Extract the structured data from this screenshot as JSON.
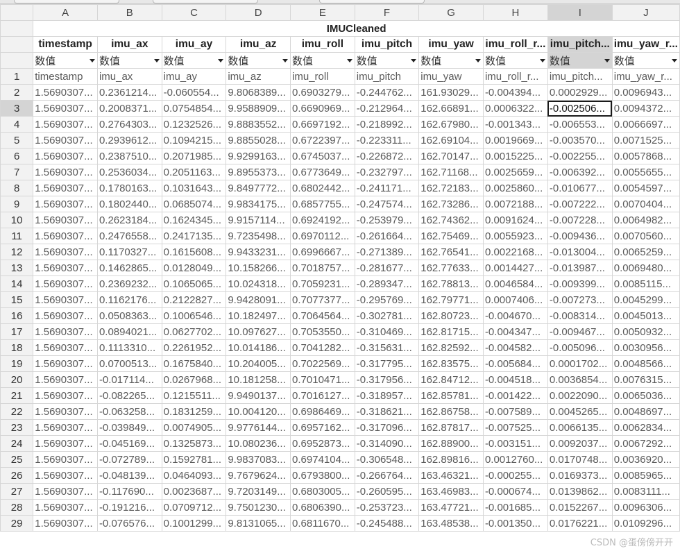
{
  "sheet": {
    "title": "IMUCleaned",
    "column_letters": [
      "A",
      "B",
      "C",
      "D",
      "E",
      "F",
      "G",
      "H",
      "I",
      "J"
    ],
    "selected_column": 8,
    "selected_row": 3,
    "field_names": [
      "timestamp",
      "imu_ax",
      "imu_ay",
      "imu_az",
      "imu_roll",
      "imu_pitch",
      "imu_yaw",
      "imu_roll_r...",
      "imu_pitch...",
      "imu_yaw_r..."
    ],
    "type_labels": [
      "数值",
      "数值",
      "数值",
      "数值",
      "数值",
      "数值",
      "数值",
      "数值",
      "数值",
      "数值"
    ],
    "rows": [
      {
        "n": "1",
        "cells": [
          "timestamp",
          "imu_ax",
          "imu_ay",
          "imu_az",
          "imu_roll",
          "imu_pitch",
          "imu_yaw",
          "imu_roll_r...",
          "imu_pitch...",
          "imu_yaw_r..."
        ]
      },
      {
        "n": "2",
        "cells": [
          "1.5690307...",
          "0.2361214...",
          "-0.060554...",
          "9.8068389...",
          "0.6903279...",
          "-0.244762...",
          "161.93029...",
          "-0.004394...",
          "0.0002929...",
          "0.0096943..."
        ]
      },
      {
        "n": "3",
        "cells": [
          "1.5690307...",
          "0.2008371...",
          "0.0754854...",
          "9.9588909...",
          "0.6690969...",
          "-0.212964...",
          "162.66891...",
          "0.0006322...",
          "-0.002506...",
          "0.0094372..."
        ]
      },
      {
        "n": "4",
        "cells": [
          "1.5690307...",
          "0.2764303...",
          "0.1232526...",
          "9.8883552...",
          "0.6697192...",
          "-0.218992...",
          "162.67980...",
          "-0.001343...",
          "-0.006553...",
          "0.0066697..."
        ]
      },
      {
        "n": "5",
        "cells": [
          "1.5690307...",
          "0.2939612...",
          "0.1094215...",
          "9.8855028...",
          "0.6722397...",
          "-0.223311...",
          "162.69104...",
          "0.0019669...",
          "-0.003570...",
          "0.0071525..."
        ]
      },
      {
        "n": "6",
        "cells": [
          "1.5690307...",
          "0.2387510...",
          "0.2071985...",
          "9.9299163...",
          "0.6745037...",
          "-0.226872...",
          "162.70147...",
          "0.0015225...",
          "-0.002255...",
          "0.0057868..."
        ]
      },
      {
        "n": "7",
        "cells": [
          "1.5690307...",
          "0.2536034...",
          "0.2051163...",
          "9.8955373...",
          "0.6773649...",
          "-0.232797...",
          "162.71168...",
          "0.0025659...",
          "-0.006392...",
          "0.0055655..."
        ]
      },
      {
        "n": "8",
        "cells": [
          "1.5690307...",
          "0.1780163...",
          "0.1031643...",
          "9.8497772...",
          "0.6802442...",
          "-0.241171...",
          "162.72183...",
          "0.0025860...",
          "-0.010677...",
          "0.0054597..."
        ]
      },
      {
        "n": "9",
        "cells": [
          "1.5690307...",
          "0.1802440...",
          "0.0685074...",
          "9.9834175...",
          "0.6857755...",
          "-0.247574...",
          "162.73286...",
          "0.0072188...",
          "-0.007222...",
          "0.0070404..."
        ]
      },
      {
        "n": "10",
        "cells": [
          "1.5690307...",
          "0.2623184...",
          "0.1624345...",
          "9.9157114...",
          "0.6924192...",
          "-0.253979...",
          "162.74362...",
          "0.0091624...",
          "-0.007228...",
          "0.0064982..."
        ]
      },
      {
        "n": "11",
        "cells": [
          "1.5690307...",
          "0.2476558...",
          "0.2417135...",
          "9.7235498...",
          "0.6970112...",
          "-0.261664...",
          "162.75469...",
          "0.0055923...",
          "-0.009436...",
          "0.0070560..."
        ]
      },
      {
        "n": "12",
        "cells": [
          "1.5690307...",
          "0.1170327...",
          "0.1615608...",
          "9.9433231...",
          "0.6996667...",
          "-0.271389...",
          "162.76541...",
          "0.0022168...",
          "-0.013004...",
          "0.0065259..."
        ]
      },
      {
        "n": "13",
        "cells": [
          "1.5690307...",
          "0.1462865...",
          "0.0128049...",
          "10.158266...",
          "0.7018757...",
          "-0.281677...",
          "162.77633...",
          "0.0014427...",
          "-0.013987...",
          "0.0069480..."
        ]
      },
      {
        "n": "14",
        "cells": [
          "1.5690307...",
          "0.2369232...",
          "0.1065065...",
          "10.024318...",
          "0.7059231...",
          "-0.289347...",
          "162.78813...",
          "0.0046584...",
          "-0.009399...",
          "0.0085115..."
        ]
      },
      {
        "n": "15",
        "cells": [
          "1.5690307...",
          "0.1162176...",
          "0.2122827...",
          "9.9428091...",
          "0.7077377...",
          "-0.295769...",
          "162.79771...",
          "0.0007406...",
          "-0.007273...",
          "0.0045299..."
        ]
      },
      {
        "n": "16",
        "cells": [
          "1.5690307...",
          "0.0508363...",
          "0.1006546...",
          "10.182497...",
          "0.7064564...",
          "-0.302781...",
          "162.80723...",
          "-0.004670...",
          "-0.008314...",
          "0.0045013..."
        ]
      },
      {
        "n": "17",
        "cells": [
          "1.5690307...",
          "0.0894021...",
          "0.0627702...",
          "10.097627...",
          "0.7053550...",
          "-0.310469...",
          "162.81715...",
          "-0.004347...",
          "-0.009467...",
          "0.0050932..."
        ]
      },
      {
        "n": "18",
        "cells": [
          "1.5690307...",
          "0.1113310...",
          "0.2261952...",
          "10.014186...",
          "0.7041282...",
          "-0.315631...",
          "162.82592...",
          "-0.004582...",
          "-0.005096...",
          "0.0030956..."
        ]
      },
      {
        "n": "19",
        "cells": [
          "1.5690307...",
          "0.0700513...",
          "0.1675840...",
          "10.204005...",
          "0.7022569...",
          "-0.317795...",
          "162.83575...",
          "-0.005684...",
          "0.0001702...",
          "0.0048566..."
        ]
      },
      {
        "n": "20",
        "cells": [
          "1.5690307...",
          "-0.017114...",
          "0.0267968...",
          "10.181258...",
          "0.7010471...",
          "-0.317956...",
          "162.84712...",
          "-0.004518...",
          "0.0036854...",
          "0.0076315..."
        ]
      },
      {
        "n": "21",
        "cells": [
          "1.5690307...",
          "-0.082265...",
          "0.1215511...",
          "9.9490137...",
          "0.7016127...",
          "-0.318957...",
          "162.85781...",
          "-0.001422...",
          "0.0022090...",
          "0.0065036..."
        ]
      },
      {
        "n": "22",
        "cells": [
          "1.5690307...",
          "-0.063258...",
          "0.1831259...",
          "10.004120...",
          "0.6986469...",
          "-0.318621...",
          "162.86758...",
          "-0.007589...",
          "0.0045265...",
          "0.0048697..."
        ]
      },
      {
        "n": "23",
        "cells": [
          "1.5690307...",
          "-0.039849...",
          "0.0074905...",
          "9.9776144...",
          "0.6957162...",
          "-0.317096...",
          "162.87817...",
          "-0.007525...",
          "0.0066135...",
          "0.0062834..."
        ]
      },
      {
        "n": "24",
        "cells": [
          "1.5690307...",
          "-0.045169...",
          "0.1325873...",
          "10.080236...",
          "0.6952873...",
          "-0.314090...",
          "162.88900...",
          "-0.003151...",
          "0.0092037...",
          "0.0067292..."
        ]
      },
      {
        "n": "25",
        "cells": [
          "1.5690307...",
          "-0.072789...",
          "0.1592781...",
          "9.9837083...",
          "0.6974104...",
          "-0.306548...",
          "162.89816...",
          "0.0012760...",
          "0.0170748...",
          "0.0036920..."
        ]
      },
      {
        "n": "26",
        "cells": [
          "1.5690307...",
          "-0.048139...",
          "0.0464093...",
          "9.7679624...",
          "0.6793800...",
          "-0.266764...",
          "163.46321...",
          "-0.000255...",
          "0.0169373...",
          "0.0085965..."
        ]
      },
      {
        "n": "27",
        "cells": [
          "1.5690307...",
          "-0.117690...",
          "0.0023687...",
          "9.7203149...",
          "0.6803005...",
          "-0.260595...",
          "163.46983...",
          "-0.000674...",
          "0.0139862...",
          "0.0083111..."
        ]
      },
      {
        "n": "28",
        "cells": [
          "1.5690307...",
          "-0.191216...",
          "0.0709712...",
          "9.7501230...",
          "0.6806390...",
          "-0.253723...",
          "163.47721...",
          "-0.001685...",
          "0.0152267...",
          "0.0096306..."
        ]
      },
      {
        "n": "29",
        "cells": [
          "1.5690307...",
          "-0.076576...",
          "0.1001299...",
          "9.8131065...",
          "0.6811670...",
          "-0.245488...",
          "163.48538...",
          "-0.001350...",
          "0.0176221...",
          "0.0109296..."
        ]
      }
    ]
  },
  "watermark": "CSDN @蛋傍傍开开"
}
